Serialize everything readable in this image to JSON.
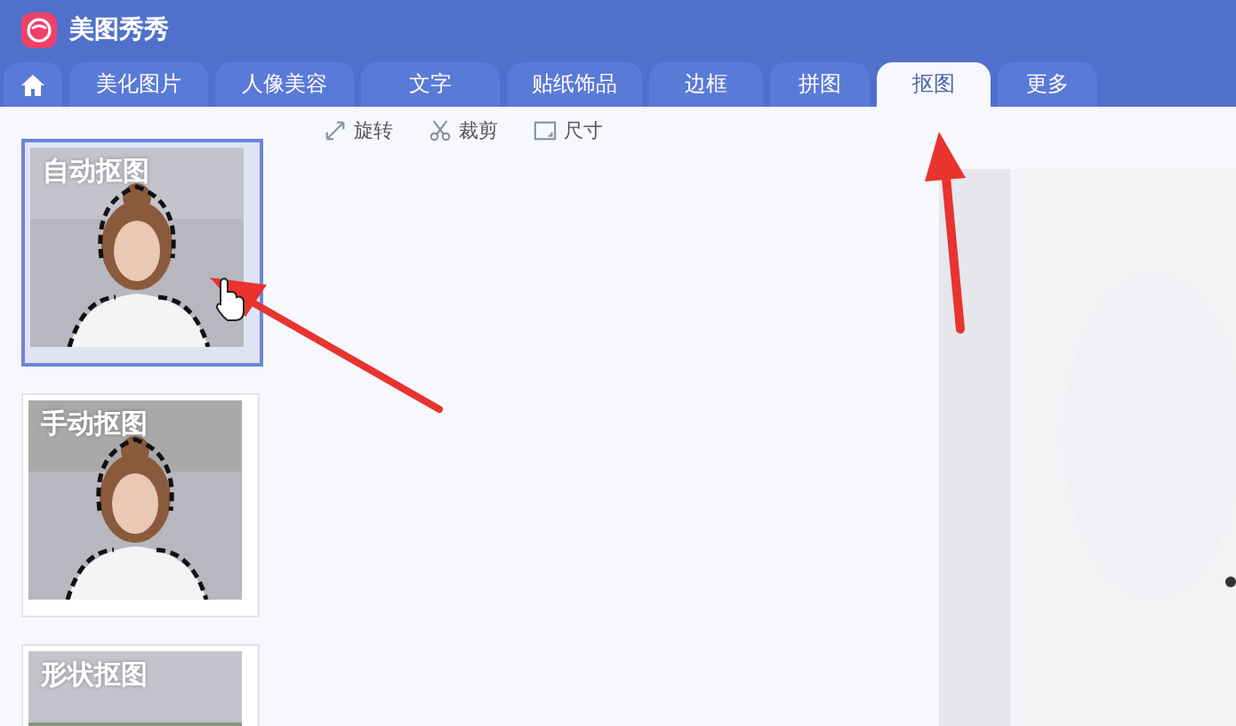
{
  "app": {
    "title": "美图秀秀"
  },
  "tabs": [
    {
      "label": "美化图片",
      "selected": false
    },
    {
      "label": "人像美容",
      "selected": false
    },
    {
      "label": "文字",
      "selected": false
    },
    {
      "label": "贴纸饰品",
      "selected": false
    },
    {
      "label": "边框",
      "selected": false
    },
    {
      "label": "拼图",
      "selected": false
    },
    {
      "label": "抠图",
      "selected": true
    },
    {
      "label": "更多",
      "selected": false
    }
  ],
  "toolbar": [
    {
      "label": "旋转",
      "kind": "rotate"
    },
    {
      "label": "裁剪",
      "kind": "crop"
    },
    {
      "label": "尺寸",
      "kind": "resize"
    }
  ],
  "modes": [
    {
      "label": "自动抠图",
      "selected": true,
      "kind": "auto"
    },
    {
      "label": "手动抠图",
      "selected": false,
      "kind": "manual"
    },
    {
      "label": "形状抠图",
      "selected": false,
      "kind": "shape"
    }
  ]
}
